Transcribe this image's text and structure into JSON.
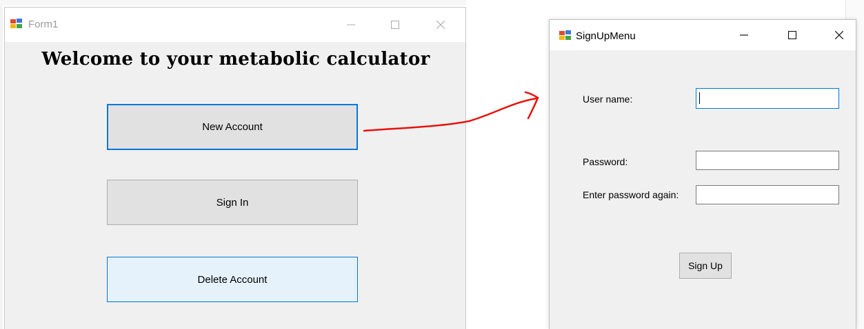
{
  "form1": {
    "title": "Form1",
    "heading": "Welcome to your metabolic calculator",
    "buttons": {
      "new_account": "New Account",
      "sign_in": "Sign In",
      "delete_account": "Delete Account"
    }
  },
  "signup": {
    "title": "SignUpMenu",
    "labels": {
      "user_name": "User name:",
      "password": "Password:",
      "password_again": "Enter password again:"
    },
    "fields": {
      "user_name": "",
      "password": "",
      "password_again": ""
    },
    "sign_up_button": "Sign Up"
  },
  "colors": {
    "accent": "#0078d7",
    "annotation_arrow": "#e8120c",
    "window_bg": "#f0f0f0",
    "button_face": "#e1e1e1",
    "hover_fill": "#e5f1fb"
  },
  "icons": {
    "app": "winforms-app-icon",
    "minimize": "minimize-icon",
    "maximize": "maximize-icon",
    "close": "close-icon",
    "annotation": "red-hand-drawn-arrow"
  }
}
